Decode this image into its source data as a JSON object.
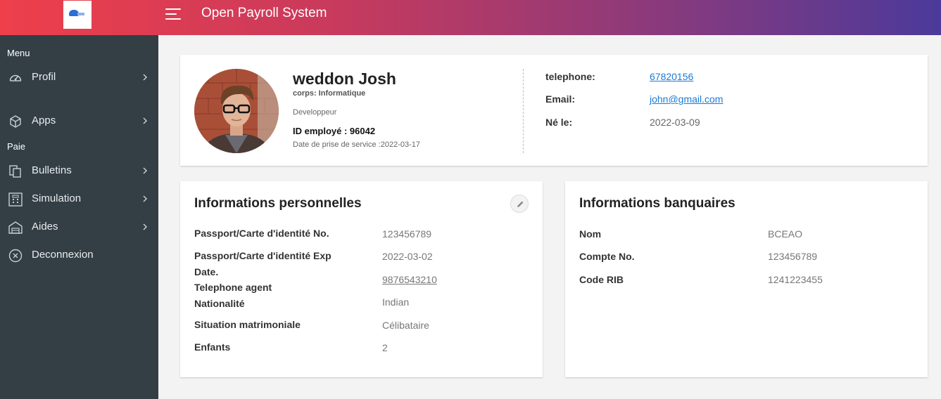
{
  "app": {
    "title": "Open Payroll System"
  },
  "sidebar": {
    "menu_label": "Menu",
    "paie_label": "Paie",
    "items": [
      {
        "label": "Profil",
        "icon": "gauge-icon"
      },
      {
        "label": "Apps",
        "icon": "cube-icon"
      },
      {
        "label": "Bulletins",
        "icon": "copy-icon"
      },
      {
        "label": "Simulation",
        "icon": "calculator-icon"
      },
      {
        "label": "Aides",
        "icon": "bank-icon"
      },
      {
        "label": "Deconnexion",
        "icon": "close-circle-icon"
      }
    ]
  },
  "profile": {
    "name": "weddon Josh",
    "corps": "corps: Informatique",
    "role": "Developpeur",
    "employee_id": "ID employé : 96042",
    "start_date": "Date de prise de service :2022-03-17",
    "contact": [
      {
        "label": "telephone:",
        "value": "67820156"
      },
      {
        "label": "Email:",
        "value": "john@gmail.com"
      },
      {
        "label": "Né le:",
        "value": "2022-03-09"
      }
    ]
  },
  "personal": {
    "title": "Informations personnelles",
    "rows": [
      {
        "label": "Passport/Carte d'identité No.",
        "value": "123456789"
      },
      {
        "label": "Passport/Carte d'identité Exp Date.",
        "value": "2022-03-02"
      },
      {
        "label": "Telephone agent",
        "value": "9876543210"
      },
      {
        "label": "Nationalité",
        "value": "Indian"
      },
      {
        "label": "Situation matrimoniale",
        "value": "Célibataire"
      },
      {
        "label": "Enfants",
        "value": "2"
      }
    ]
  },
  "bank": {
    "title": "Informations banquaires",
    "rows": [
      {
        "label": "Nom",
        "value": "BCEAO"
      },
      {
        "label": "Compte No.",
        "value": "123456789"
      },
      {
        "label": "Code RIB",
        "value": "1241223455"
      }
    ]
  },
  "colors": {
    "header_gradient_start": "#ee3f4b",
    "header_gradient_end": "#4b3a9a",
    "sidebar_bg": "#333f45",
    "link": "#1a7ad6"
  }
}
